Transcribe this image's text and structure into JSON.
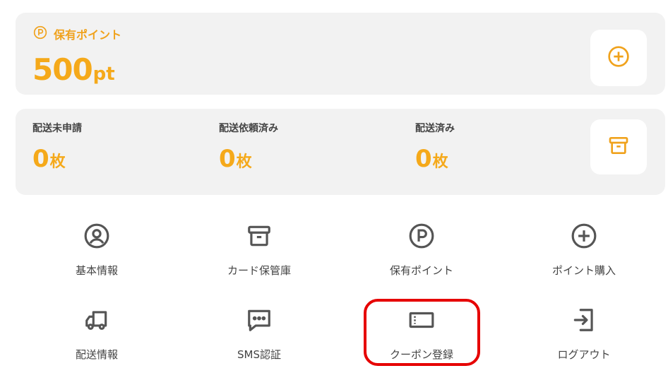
{
  "points_card": {
    "label": "保有ポイント",
    "value": "500",
    "unit": "pt",
    "accent_color": "#f5a91a",
    "label_icon": "p-circle-icon",
    "action_icon": "plus-circle-icon"
  },
  "shipping_card": {
    "columns": [
      {
        "label": "配送未申請",
        "value": "0",
        "unit": "枚"
      },
      {
        "label": "配送依頼済み",
        "value": "0",
        "unit": "枚"
      },
      {
        "label": "配送済み",
        "value": "0",
        "unit": "枚"
      }
    ],
    "action_icon": "archive-box-icon"
  },
  "menu": [
    {
      "label": "基本情報",
      "icon": "user-circle-icon"
    },
    {
      "label": "カード保管庫",
      "icon": "archive-box-icon"
    },
    {
      "label": "保有ポイント",
      "icon": "p-circle-icon"
    },
    {
      "label": "ポイント購入",
      "icon": "plus-circle-icon"
    },
    {
      "label": "配送情報",
      "icon": "truck-icon"
    },
    {
      "label": "SMS認証",
      "icon": "chat-bubble-icon"
    },
    {
      "label": "クーポン登録",
      "icon": "ticket-icon",
      "highlighted": true
    },
    {
      "label": "ログアウト",
      "icon": "logout-icon"
    }
  ],
  "highlight_color": "#e60000"
}
